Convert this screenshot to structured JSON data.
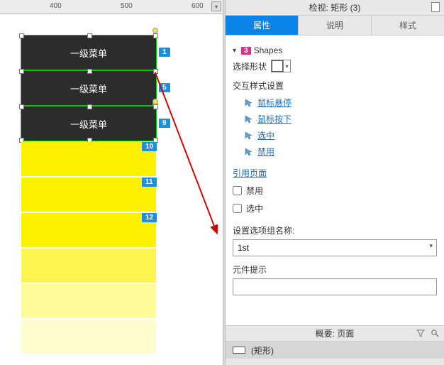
{
  "ruler": {
    "ticks": [
      "400",
      "500",
      "600"
    ]
  },
  "canvas": {
    "menu_items": [
      "一级菜单",
      "一级菜单",
      "一级菜单"
    ],
    "badges": [
      "1",
      "5",
      "9",
      "10",
      "11",
      "12"
    ]
  },
  "inspector": {
    "title": "检视: 矩形 (3)",
    "tabs": {
      "props": "属性",
      "notes": "说明",
      "styles": "样式"
    },
    "shapes_count": "3",
    "shapes_label": "Shapes",
    "select_shape_label": "选择形状",
    "interaction_title": "交互样式设置",
    "links": {
      "hover": "鼠标悬停",
      "down": "鼠标按下",
      "selected": "选中",
      "disabled": "禁用"
    },
    "ref_page_title": "引用页面",
    "chk_disabled": "禁用",
    "chk_selected": "选中",
    "group_name_label": "设置选项组名称:",
    "group_name_value": "1st",
    "tooltip_label": "元件提示",
    "tooltip_value": ""
  },
  "outline": {
    "title": "概要: 页面",
    "item": "(矩形)"
  }
}
